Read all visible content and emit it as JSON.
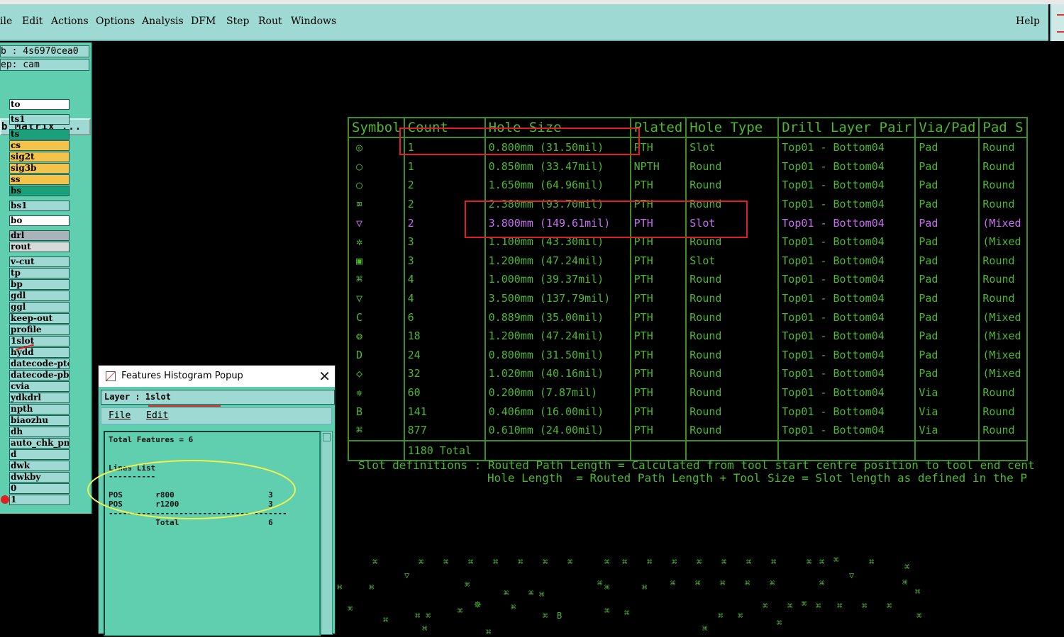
{
  "menubar": {
    "items": [
      {
        "label": "ile",
        "u": ""
      },
      {
        "label": "Edit",
        "u": "E"
      },
      {
        "label": "Actions",
        "u": "A"
      },
      {
        "label": "Options",
        "u": "O"
      },
      {
        "label": "Analysis",
        "u": "A"
      },
      {
        "label": "DFM",
        "u": ""
      },
      {
        "label": "Step",
        "u": "S"
      },
      {
        "label": "Rout",
        "u": "R"
      },
      {
        "label": "Windows",
        "u": "W"
      }
    ],
    "help": "Help"
  },
  "left_panel": {
    "job": "b : 4s6970cea0",
    "step": "ep: cam",
    "matrix_button": "b Matrix ...",
    "layers": [
      {
        "name": "to",
        "color": "#ffffff"
      },
      {
        "name": "ts1",
        "color": "#9fd9d3"
      },
      {
        "name": "ts",
        "color": "#1aa07a"
      },
      {
        "name": "cs",
        "color": "#f5c24a"
      },
      {
        "name": "sig2t",
        "color": "#f5c24a"
      },
      {
        "name": "sig3b",
        "color": "#f5c24a"
      },
      {
        "name": "ss",
        "color": "#f5c24a"
      },
      {
        "name": "bs",
        "color": "#1aa07a"
      },
      {
        "name": "bs1",
        "color": "#9fd9d3"
      },
      {
        "name": "bo",
        "color": "#ffffff"
      },
      {
        "name": "drl",
        "color": "#a9b4b9"
      },
      {
        "name": "rout",
        "color": "#d8dada"
      },
      {
        "name": "v-cut",
        "color": "#9fd9d3"
      },
      {
        "name": "tp",
        "color": "#9fd9d3"
      },
      {
        "name": "bp",
        "color": "#9fd9d3"
      },
      {
        "name": "gdl",
        "color": "#9fd9d3"
      },
      {
        "name": "ggl",
        "color": "#9fd9d3"
      },
      {
        "name": "keep-out",
        "color": "#9fd9d3"
      },
      {
        "name": "profile",
        "color": "#9fd9d3"
      },
      {
        "name": "1slot",
        "color": "#9fd9d3"
      },
      {
        "name": "hydd",
        "color": "#9fd9d3"
      },
      {
        "name": "datecode-pto",
        "color": "#9fd9d3"
      },
      {
        "name": "datecode-pbo",
        "color": "#9fd9d3"
      },
      {
        "name": "cvia",
        "color": "#9fd9d3"
      },
      {
        "name": "ydkdrl",
        "color": "#9fd9d3"
      },
      {
        "name": "npth",
        "color": "#9fd9d3"
      },
      {
        "name": "biaozhu",
        "color": "#9fd9d3"
      },
      {
        "name": "dh",
        "color": "#9fd9d3"
      },
      {
        "name": "auto_chk_pn",
        "color": "#9fd9d3"
      },
      {
        "name": "d",
        "color": "#9fd9d3"
      },
      {
        "name": "dwk",
        "color": "#9fd9d3"
      },
      {
        "name": "dwkby",
        "color": "#9fd9d3"
      },
      {
        "name": "0",
        "color": "#9fd9d3"
      },
      {
        "name": "1",
        "color": "#9fd9d3"
      }
    ]
  },
  "popup": {
    "title": "Features Histogram Popup",
    "close": "✕",
    "layer_label": "Layer :  1slot",
    "menu": [
      "File",
      "Edit"
    ],
    "lines": [
      "Total Features = 6",
      "",
      "",
      "Lines List",
      "----------",
      "",
      "POS       r800                    3",
      "POS       r1200                   3",
      "--------------------------------------",
      "          Total                   6"
    ]
  },
  "drill_table": {
    "headers": [
      "Symbol",
      "Count",
      "Hole Size",
      "Plated",
      "Hole Type",
      "Drill Layer Pair",
      "Via/Pad",
      "Pad S"
    ],
    "rows": [
      {
        "sym": "◎",
        "count": "1",
        "size": "0.800mm (31.50mil)",
        "plated": "PTH",
        "type": "Slot",
        "pair": "Top01 - Bottom04",
        "vp": "Pad",
        "pad": "Round"
      },
      {
        "sym": "○",
        "count": "1",
        "size": "0.850mm (33.47mil)",
        "plated": "NPTH",
        "type": "Round",
        "pair": "Top01 - Bottom04",
        "vp": "Pad",
        "pad": "Round"
      },
      {
        "sym": "○",
        "count": "2",
        "size": "1.650mm (64.96mil)",
        "plated": "PTH",
        "type": "Round",
        "pair": "Top01 - Bottom04",
        "vp": "Pad",
        "pad": "Round"
      },
      {
        "sym": "⌧",
        "count": "2",
        "size": "2.380mm (93.70mil)",
        "plated": "PTH",
        "type": "Round",
        "pair": "Top01 - Bottom04",
        "vp": "Pad",
        "pad": "Round"
      },
      {
        "sym": "▽",
        "count": "2",
        "size": "3.800mm (149.61mil)",
        "plated": "PTH",
        "type": "Slot",
        "pair": "Top01 - Bottom04",
        "vp": "Pad",
        "pad": "(Mixed"
      },
      {
        "sym": "✲",
        "count": "3",
        "size": "1.100mm (43.30mil)",
        "plated": "PTH",
        "type": "Round",
        "pair": "Top01 - Bottom04",
        "vp": "Pad",
        "pad": "(Mixed"
      },
      {
        "sym": "▣",
        "count": "3",
        "size": "1.200mm (47.24mil)",
        "plated": "PTH",
        "type": "Slot",
        "pair": "Top01 - Bottom04",
        "vp": "Pad",
        "pad": "Round"
      },
      {
        "sym": "⌘",
        "count": "4",
        "size": "1.000mm (39.37mil)",
        "plated": "PTH",
        "type": "Round",
        "pair": "Top01 - Bottom04",
        "vp": "Pad",
        "pad": "Round"
      },
      {
        "sym": "▽",
        "count": "4",
        "size": "3.500mm (137.79mil)",
        "plated": "PTH",
        "type": "Round",
        "pair": "Top01 - Bottom04",
        "vp": "Pad",
        "pad": "Round"
      },
      {
        "sym": "C",
        "count": "6",
        "size": "0.889mm (35.00mil)",
        "plated": "PTH",
        "type": "Round",
        "pair": "Top01 - Bottom04",
        "vp": "Pad",
        "pad": "(Mixed"
      },
      {
        "sym": "❂",
        "count": "18",
        "size": "1.200mm (47.24mil)",
        "plated": "PTH",
        "type": "Round",
        "pair": "Top01 - Bottom04",
        "vp": "Pad",
        "pad": "(Mixed"
      },
      {
        "sym": "D",
        "count": "24",
        "size": "0.800mm (31.50mil)",
        "plated": "PTH",
        "type": "Round",
        "pair": "Top01 - Bottom04",
        "vp": "Pad",
        "pad": "(Mixed"
      },
      {
        "sym": "◇",
        "count": "32",
        "size": "1.020mm (40.16mil)",
        "plated": "PTH",
        "type": "Round",
        "pair": "Top01 - Bottom04",
        "vp": "Pad",
        "pad": "(Mixed"
      },
      {
        "sym": "✵",
        "count": "60",
        "size": "0.200mm (7.87mil)",
        "plated": "PTH",
        "type": "Round",
        "pair": "Top01 - Bottom04",
        "vp": "Via",
        "pad": "Round"
      },
      {
        "sym": "B",
        "count": "141",
        "size": "0.406mm (16.00mil)",
        "plated": "PTH",
        "type": "Round",
        "pair": "Top01 - Bottom04",
        "vp": "Via",
        "pad": "Round"
      },
      {
        "sym": "⌘",
        "count": "877",
        "size": "0.610mm (24.00mil)",
        "plated": "PTH",
        "type": "Round",
        "pair": "Top01 - Bottom04",
        "vp": "Via",
        "pad": "Round"
      }
    ],
    "total": "1180 Total",
    "slot_def_1": "Slot definitions : Routed Path Length = Calculated from tool start centre position to tool end cent",
    "slot_def_2": "Hole Length  = Routed Path Length + Tool Size = Slot length as defined in the P"
  },
  "colors": {
    "canvas": "#000000",
    "table_text": "#4cb830",
    "highlight_text": "#c76ef0",
    "panel": "#5fcfb0",
    "menubar": "#9fd9d3",
    "annotation_red": "#e02020",
    "annotation_yellow": "#f0f050"
  }
}
